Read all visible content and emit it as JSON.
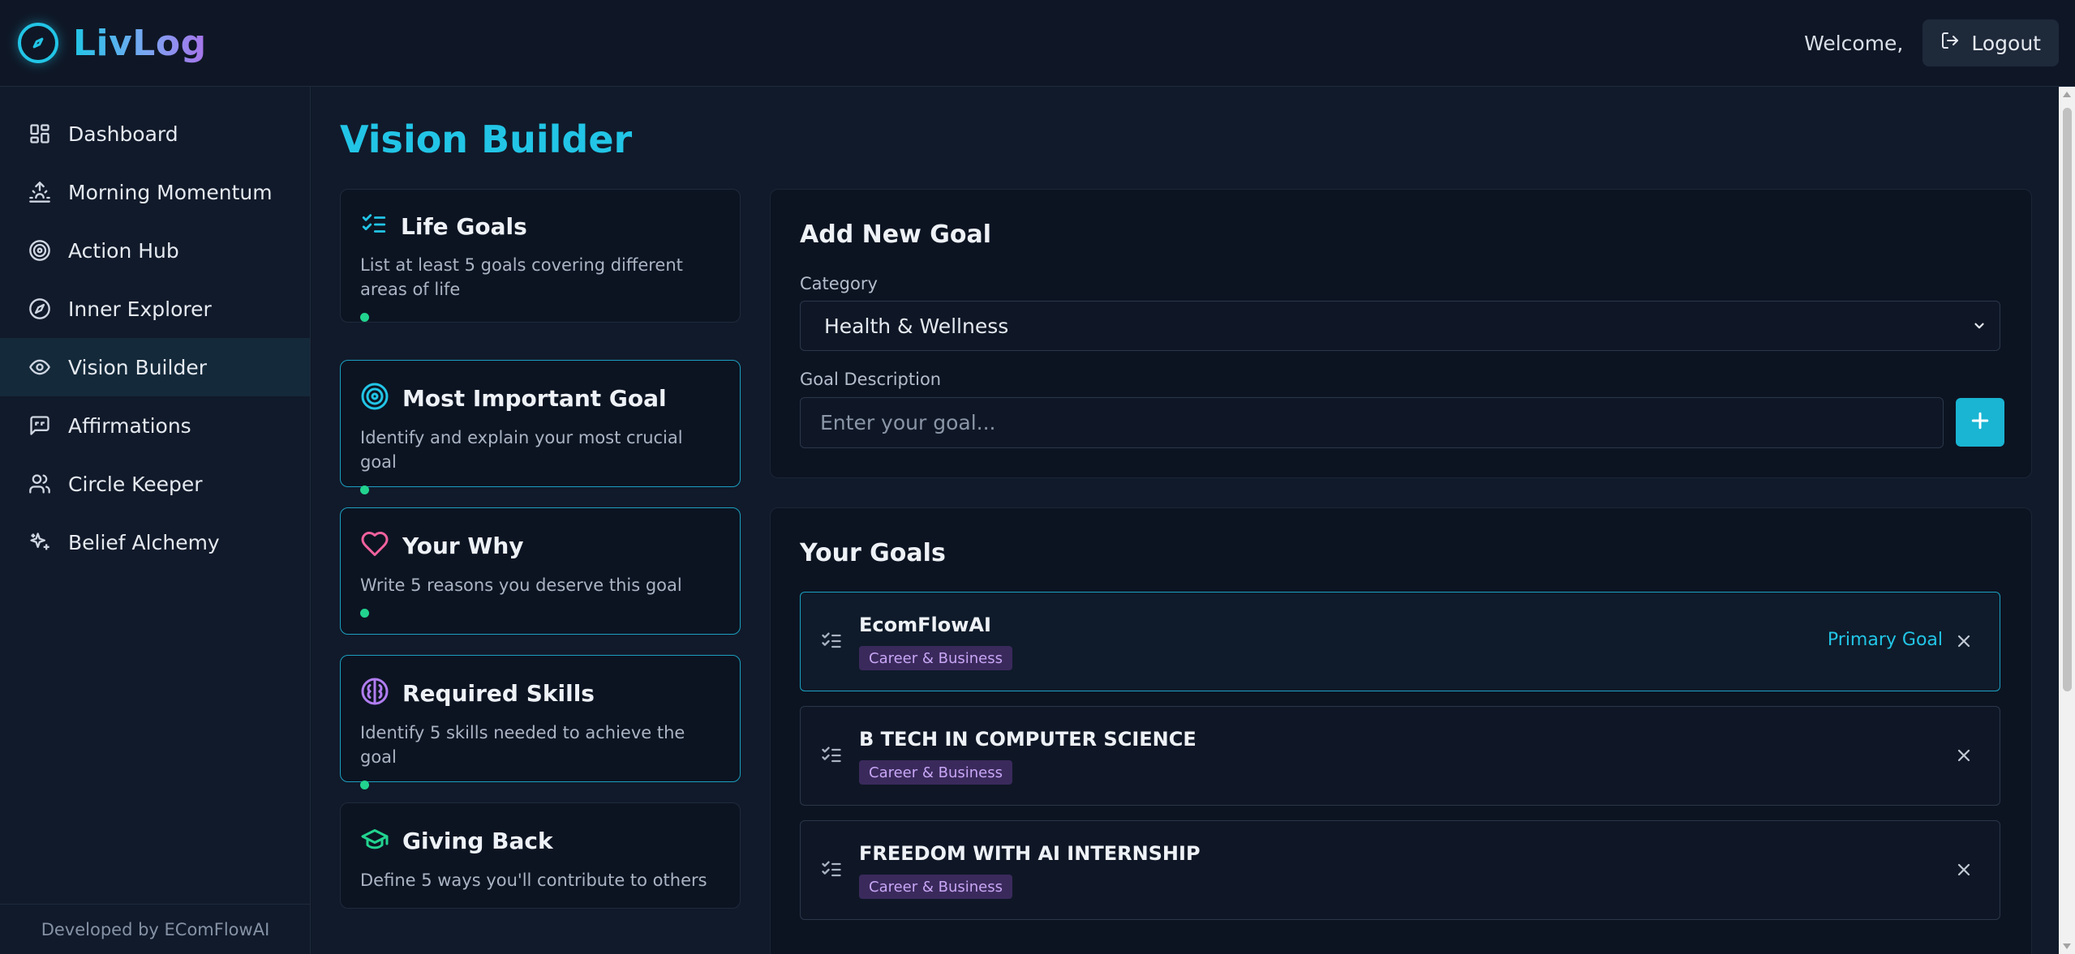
{
  "brand": {
    "name": "LivLog",
    "logo_icon": "compass-icon"
  },
  "header": {
    "welcome": "Welcome,",
    "logout_label": "Logout",
    "logout_icon": "logout-icon"
  },
  "sidebar": {
    "items": [
      {
        "label": "Dashboard",
        "icon": "dashboard-icon"
      },
      {
        "label": "Morning Momentum",
        "icon": "sunrise-icon"
      },
      {
        "label": "Action Hub",
        "icon": "target-icon"
      },
      {
        "label": "Inner Explorer",
        "icon": "compass-icon"
      },
      {
        "label": "Vision Builder",
        "icon": "eye-icon",
        "active": true
      },
      {
        "label": "Affirmations",
        "icon": "message-quote-icon"
      },
      {
        "label": "Circle Keeper",
        "icon": "users-icon"
      },
      {
        "label": "Belief Alchemy",
        "icon": "sparkles-icon"
      }
    ],
    "footer": "Developed by EComFlowAI"
  },
  "main": {
    "title": "Vision Builder",
    "steps": [
      {
        "title": "Life Goals",
        "desc": "List at least 5 goals covering different areas of life",
        "icon": "list-checks-icon",
        "icon_color": "#22c5e6"
      },
      {
        "title": "Most Important Goal",
        "desc": "Identify and explain your most crucial goal",
        "icon": "target-icon",
        "icon_color": "#22c5e6"
      },
      {
        "title": "Your Why",
        "desc": "Write 5 reasons you deserve this goal",
        "icon": "heart-icon",
        "icon_color": "#f0619e"
      },
      {
        "title": "Required Skills",
        "desc": "Identify 5 skills needed to achieve the goal",
        "icon": "brain-icon",
        "icon_color": "#b07df0"
      },
      {
        "title": "Giving Back",
        "desc": "Define 5 ways you'll contribute to others",
        "icon": "graduation-cap-icon",
        "icon_color": "#22d38f"
      }
    ],
    "add_goal": {
      "title": "Add New Goal",
      "category_label": "Category",
      "category_value": "Health & Wellness",
      "description_label": "Goal Description",
      "description_placeholder": "Enter your goal..."
    },
    "your_goals": {
      "title": "Your Goals",
      "primary_label": "Primary Goal",
      "items": [
        {
          "name": "EcomFlowAI",
          "category": "Career & Business",
          "primary": true
        },
        {
          "name": "B TECH IN COMPUTER SCIENCE",
          "category": "Career & Business"
        },
        {
          "name": "FREEDOM WITH AI INTERNSHIP",
          "category": "Career & Business"
        }
      ]
    }
  },
  "colors": {
    "accent": "#22c5e6",
    "tag_bg": "#3a2a5c",
    "tag_text": "#c8a6f5",
    "dot": "#22d38f"
  }
}
